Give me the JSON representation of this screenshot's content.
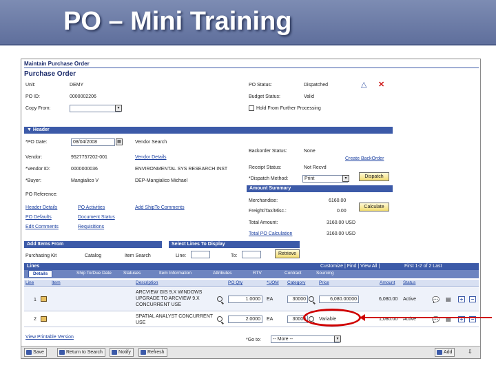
{
  "slide": {
    "title": "PO – Mini Training"
  },
  "app": {
    "breadcrumb": "Maintain Purchase Order",
    "page_title": "Purchase Order"
  },
  "po": {
    "unit_label": "Unit:",
    "unit_value": "DEMY",
    "po_id_label": "PO ID:",
    "po_id_value": "0000002206",
    "copy_from_label": "Copy From:",
    "status_label": "PO Status:",
    "status_value": "Dispatched",
    "budget_label": "Budget Status:",
    "budget_value": "Valid",
    "hold_label": "Hold From Further Processing"
  },
  "header_section": {
    "title": "Header",
    "po_date_label": "*PO Date:",
    "po_date_value": "08/04/2008",
    "vendor_search": "Vendor Search",
    "vendor_label": "Vendor:",
    "vendor_value": "9527757202-001",
    "vendor_details": "Vendor Details",
    "vendor_id_label": "*Vendor ID:",
    "vendor_id_value": "0000000036",
    "vendor_name": "ENVIRONMENTAL SYS RESEARCH INST",
    "buyer_label": "*Buyer:",
    "buyer_value": "Mangialico V",
    "buyer_name": "DEP-Mangialico Michael",
    "po_reference_label": "PO Reference:",
    "backorder_label": "Backorder Status:",
    "backorder_value": "None",
    "create_backorder": "Create BackOrder",
    "receipt_label": "Receipt Status:",
    "receipt_value": "Not Recvd",
    "dispatch_method_label": "*Dispatch Method:",
    "dispatch_method_value": "Print",
    "dispatch_button": "Dispatch"
  },
  "header_links": {
    "header_details": "Header Details",
    "po_activities": "PO Activities",
    "add_ship_to": "Add ShipTo Comments",
    "po_defaults": "PO Defaults",
    "document_status": "Document Status",
    "edit_comments": "Edit Comments",
    "requisitions": "Requisitions"
  },
  "amount_summary": {
    "title": "Amount Summary",
    "merchandise_label": "Merchandise:",
    "merchandise_value": "6160.00",
    "freight_label": "Freight/Tax/Misc.:",
    "freight_value": "0.00",
    "calculate_button": "Calculate",
    "total_label": "Total Amount:",
    "total_value": "3160.00 USD",
    "calc_link": "Total PO Calculation",
    "calc_value": "3160.00 USD"
  },
  "add_items": {
    "title": "Add Items From",
    "purchasing_kit": "Purchasing Kit",
    "catalog": "Catalog",
    "item_search": "Item Search"
  },
  "select_lines": {
    "title": "Select Lines To Display",
    "line_label": "Line:",
    "to_label": "To:",
    "retrieve_button": "Retrieve"
  },
  "lines_grid": {
    "title": "Lines",
    "nav": "Customize | Find | View All |",
    "paging": "First  1-2 of 2  Last",
    "tabs": [
      "Details",
      "Ship To/Due Date",
      "Statuses",
      "Item Information",
      "Attributes",
      "RTV",
      "Contract",
      "Sourcing"
    ],
    "headers": {
      "line": "Line",
      "item": "Item",
      "description": "Description",
      "po_qty": "PO Qty",
      "uom": "*UOM",
      "category": "Category",
      "price": "Price",
      "amount": "Amount",
      "status": "Status"
    },
    "rows": [
      {
        "line": "1",
        "description": "ARCVIEW GIS 9.X WINDOWS UPGRADE TO ARCVIEW 9.X CONCURRENT USE",
        "qty": "1.0000",
        "uom": "EA",
        "category": "30000",
        "price": "6,080.00000",
        "amount": "6,080.00",
        "status": "Active"
      },
      {
        "line": "2",
        "description": "SPATIAL ANALYST CONCURRENT USE",
        "qty": "2.0000",
        "uom": "EA",
        "category": "30000",
        "price": "Variable",
        "amount": "1,080.00",
        "status": "Active"
      }
    ]
  },
  "footer": {
    "view_printable": "View Printable Version",
    "goto_label": "*Go to:",
    "goto_value": "-- More --"
  },
  "toolbar": {
    "save": "Save",
    "return_search": "Return to Search",
    "notify": "Notify",
    "refresh": "Refresh",
    "add": "Add"
  }
}
